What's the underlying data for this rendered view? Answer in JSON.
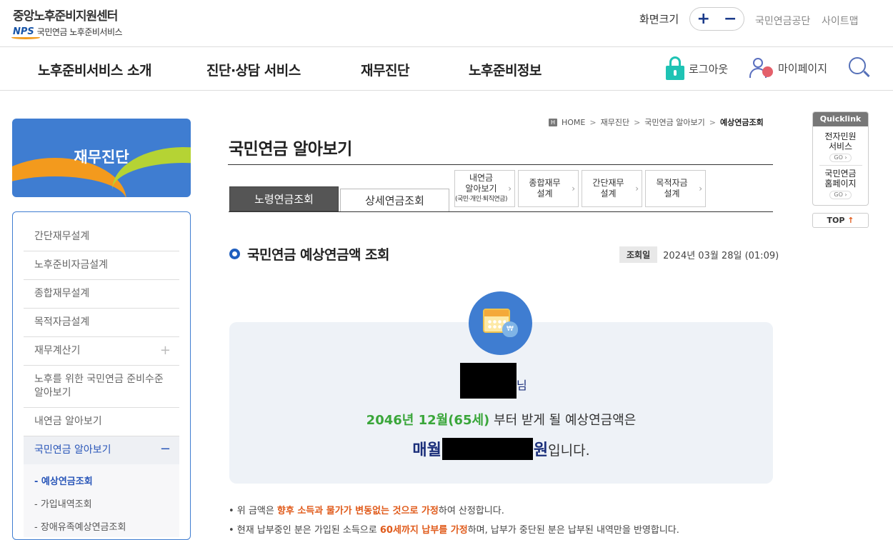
{
  "header": {
    "logo_title": "중앙노후준비지원센터",
    "logo_nps": "NPS",
    "logo_sub": "국민연금 노후준비서비스",
    "zoom_label": "화면크기",
    "zoom_in": "+",
    "zoom_out": "−",
    "links": [
      "국민연금공단",
      "사이트맵"
    ]
  },
  "gnb": {
    "items": [
      "노후준비서비스 소개",
      "진단·상담 서비스",
      "재무진단",
      "노후준비정보"
    ],
    "logout": "로그아웃",
    "mypage": "마이페이지"
  },
  "lnb": {
    "banner_title": "재무진단",
    "items": [
      "간단재무설계",
      "노후준비자금설계",
      "종합재무설계",
      "목적자금설계",
      "재무계산기",
      "노후를 위한 국민연금 준비수준 알아보기",
      "내연금 알아보기"
    ],
    "active_item": "국민연금 알아보기",
    "sub_items": [
      "- 예상연금조회",
      "- 가입내역조회",
      "- 장애유족예상연금조회"
    ]
  },
  "breadcrumb": {
    "home": "HOME",
    "items": [
      "재무진단",
      "국민연금 알아보기"
    ],
    "current": "예상연금조회",
    "sep": ">"
  },
  "page": {
    "title": "국민연금 알아보기",
    "tabs": {
      "active": "노령연금조회",
      "normal": "상세연금조회",
      "links": [
        {
          "line1": "내연금",
          "line2": "알아보기",
          "line3": "(국민·개인·퇴직연금)"
        },
        {
          "line1": "종합재무",
          "line2": "설계"
        },
        {
          "line1": "간단재무",
          "line2": "설계"
        },
        {
          "line1": "목적자금",
          "line2": "설계"
        }
      ]
    },
    "section_title": "국민연금 예상연금액 조회",
    "query_label": "조회일",
    "query_date": "2024년 03월 28일 (01:09)"
  },
  "result": {
    "name_suffix": "님",
    "start_date": "2046년 12월(65세)",
    "msg1_rest": " 부터 받게 될 예상연금액은",
    "monthly": "매월",
    "won": "원",
    "ending": "입니다."
  },
  "notes": {
    "n1_prefix": "• 위 금액은 ",
    "n1_hl": "향후 소득과 물가가 변동없는 것으로 가정",
    "n1_suffix": "하여 산정합니다.",
    "n2_prefix": "• 현재 납부중인 분은 가입된 소득으로 ",
    "n2_hl": "60세까지 납부를 가정",
    "n2_suffix": "하며, 납부가 중단된 분은 납부된 내역만을 반영합니다."
  },
  "quicklink": {
    "title": "Quicklink",
    "items": [
      {
        "line1": "전자민원",
        "line2": "서비스",
        "go": "GO ›"
      },
      {
        "line1": "국민연금",
        "line2": "홈페이지",
        "go": "GO ›"
      }
    ],
    "top": "TOP",
    "top_arrow": "↑"
  }
}
